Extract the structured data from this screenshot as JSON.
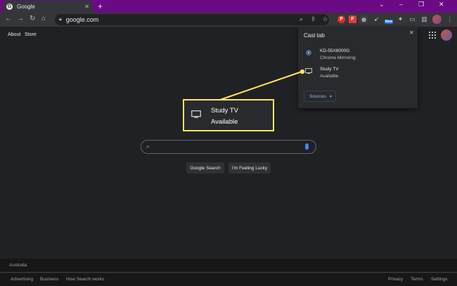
{
  "browser": {
    "tab_title": "Google",
    "tab_favicon": "G",
    "tab_close": "✕",
    "new_tab": "+",
    "window_controls": [
      "⌄",
      "–",
      "❐",
      "✕"
    ],
    "url": "google.com",
    "extension_new_badge": "New"
  },
  "google": {
    "top_links": [
      "About",
      "Store"
    ],
    "search_placeholder": "",
    "buttons": [
      "Google Search",
      "I'm Feeling Lucky"
    ],
    "footer_country": "Australia",
    "footer_left": [
      "Advertising",
      "Business",
      "How Search works"
    ],
    "footer_right": [
      "Privacy",
      "Terms",
      "Settings"
    ]
  },
  "cast_dialog": {
    "title": "Cast tab",
    "close": "✕",
    "devices": [
      {
        "name": "KD-55X8000G",
        "status": "Chrome Mirroring",
        "icon": "cast-active-icon"
      },
      {
        "name": "Study TV",
        "status": "Available",
        "icon": "tv-icon"
      }
    ],
    "sources_label": "Sources"
  },
  "callout": {
    "line1": "Study TV",
    "line2": "Available"
  },
  "colors": {
    "tabstrip": "#6a0a85",
    "highlight": "#ffe75a",
    "link_blue": "#8ab4f8",
    "background": "#202124"
  }
}
